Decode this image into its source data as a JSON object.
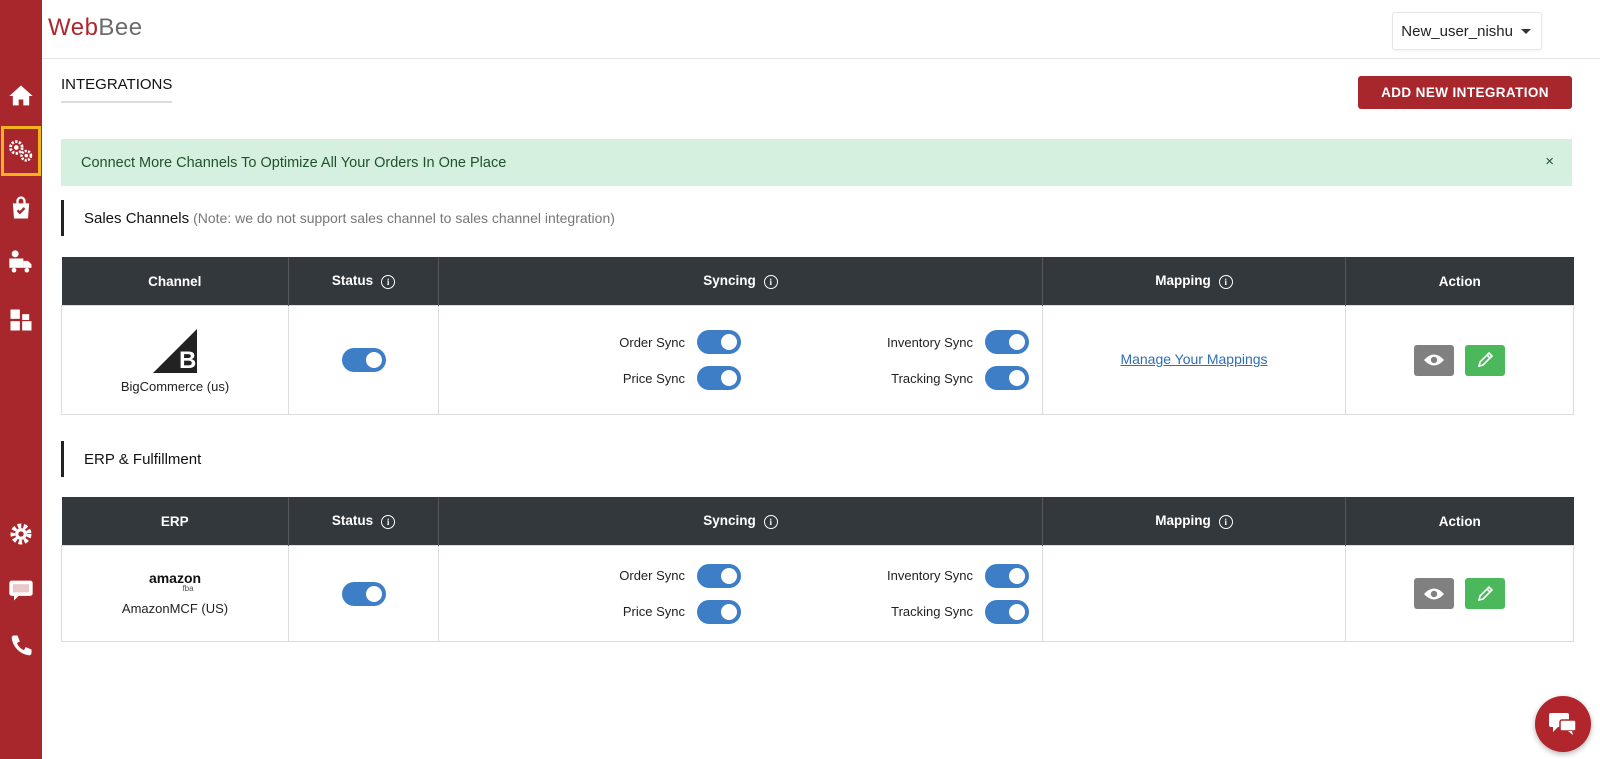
{
  "brand": {
    "logo_part1": "Web",
    "logo_part2": "Bee",
    "accent": "#a8272d"
  },
  "header": {
    "user": "New_user_nishu"
  },
  "sidebar": {
    "items": [
      {
        "name": "home-icon"
      },
      {
        "name": "integrations-gear-icon",
        "active": true
      },
      {
        "name": "orders-bag-icon"
      },
      {
        "name": "shipping-truck-icon"
      },
      {
        "name": "inventory-boxes-icon"
      },
      {
        "name": "settings-gear-icon"
      },
      {
        "name": "chat-icon"
      },
      {
        "name": "phone-icon"
      }
    ]
  },
  "page": {
    "title": "INTEGRATIONS",
    "add_button": "ADD NEW INTEGRATION"
  },
  "banner": {
    "text": "Connect More Channels To Optimize All Your Orders In One Place",
    "close": "×"
  },
  "sales": {
    "title": "Sales Channels",
    "note": "(Note: we do not support sales channel to sales channel integration)",
    "headers": {
      "channel": "Channel",
      "status": "Status",
      "syncing": "Syncing",
      "mapping": "Mapping",
      "action": "Action"
    },
    "row": {
      "name": "BigCommerce (us)",
      "logo": "B",
      "status_on": true,
      "order_sync": "Order Sync",
      "inventory_sync": "Inventory Sync",
      "price_sync": "Price Sync",
      "tracking_sync": "Tracking Sync",
      "mapping_link": "Manage Your Mappings"
    }
  },
  "erp": {
    "title": "ERP & Fulfillment",
    "headers": {
      "channel": "ERP",
      "status": "Status",
      "syncing": "Syncing",
      "mapping": "Mapping",
      "action": "Action"
    },
    "row": {
      "name": "AmazonMCF (US)",
      "logo_word": "amazon",
      "logo_sub": "fba",
      "status_on": true,
      "order_sync": "Order Sync",
      "inventory_sync": "Inventory Sync",
      "price_sync": "Price Sync",
      "tracking_sync": "Tracking Sync"
    }
  },
  "info_glyph": "i"
}
